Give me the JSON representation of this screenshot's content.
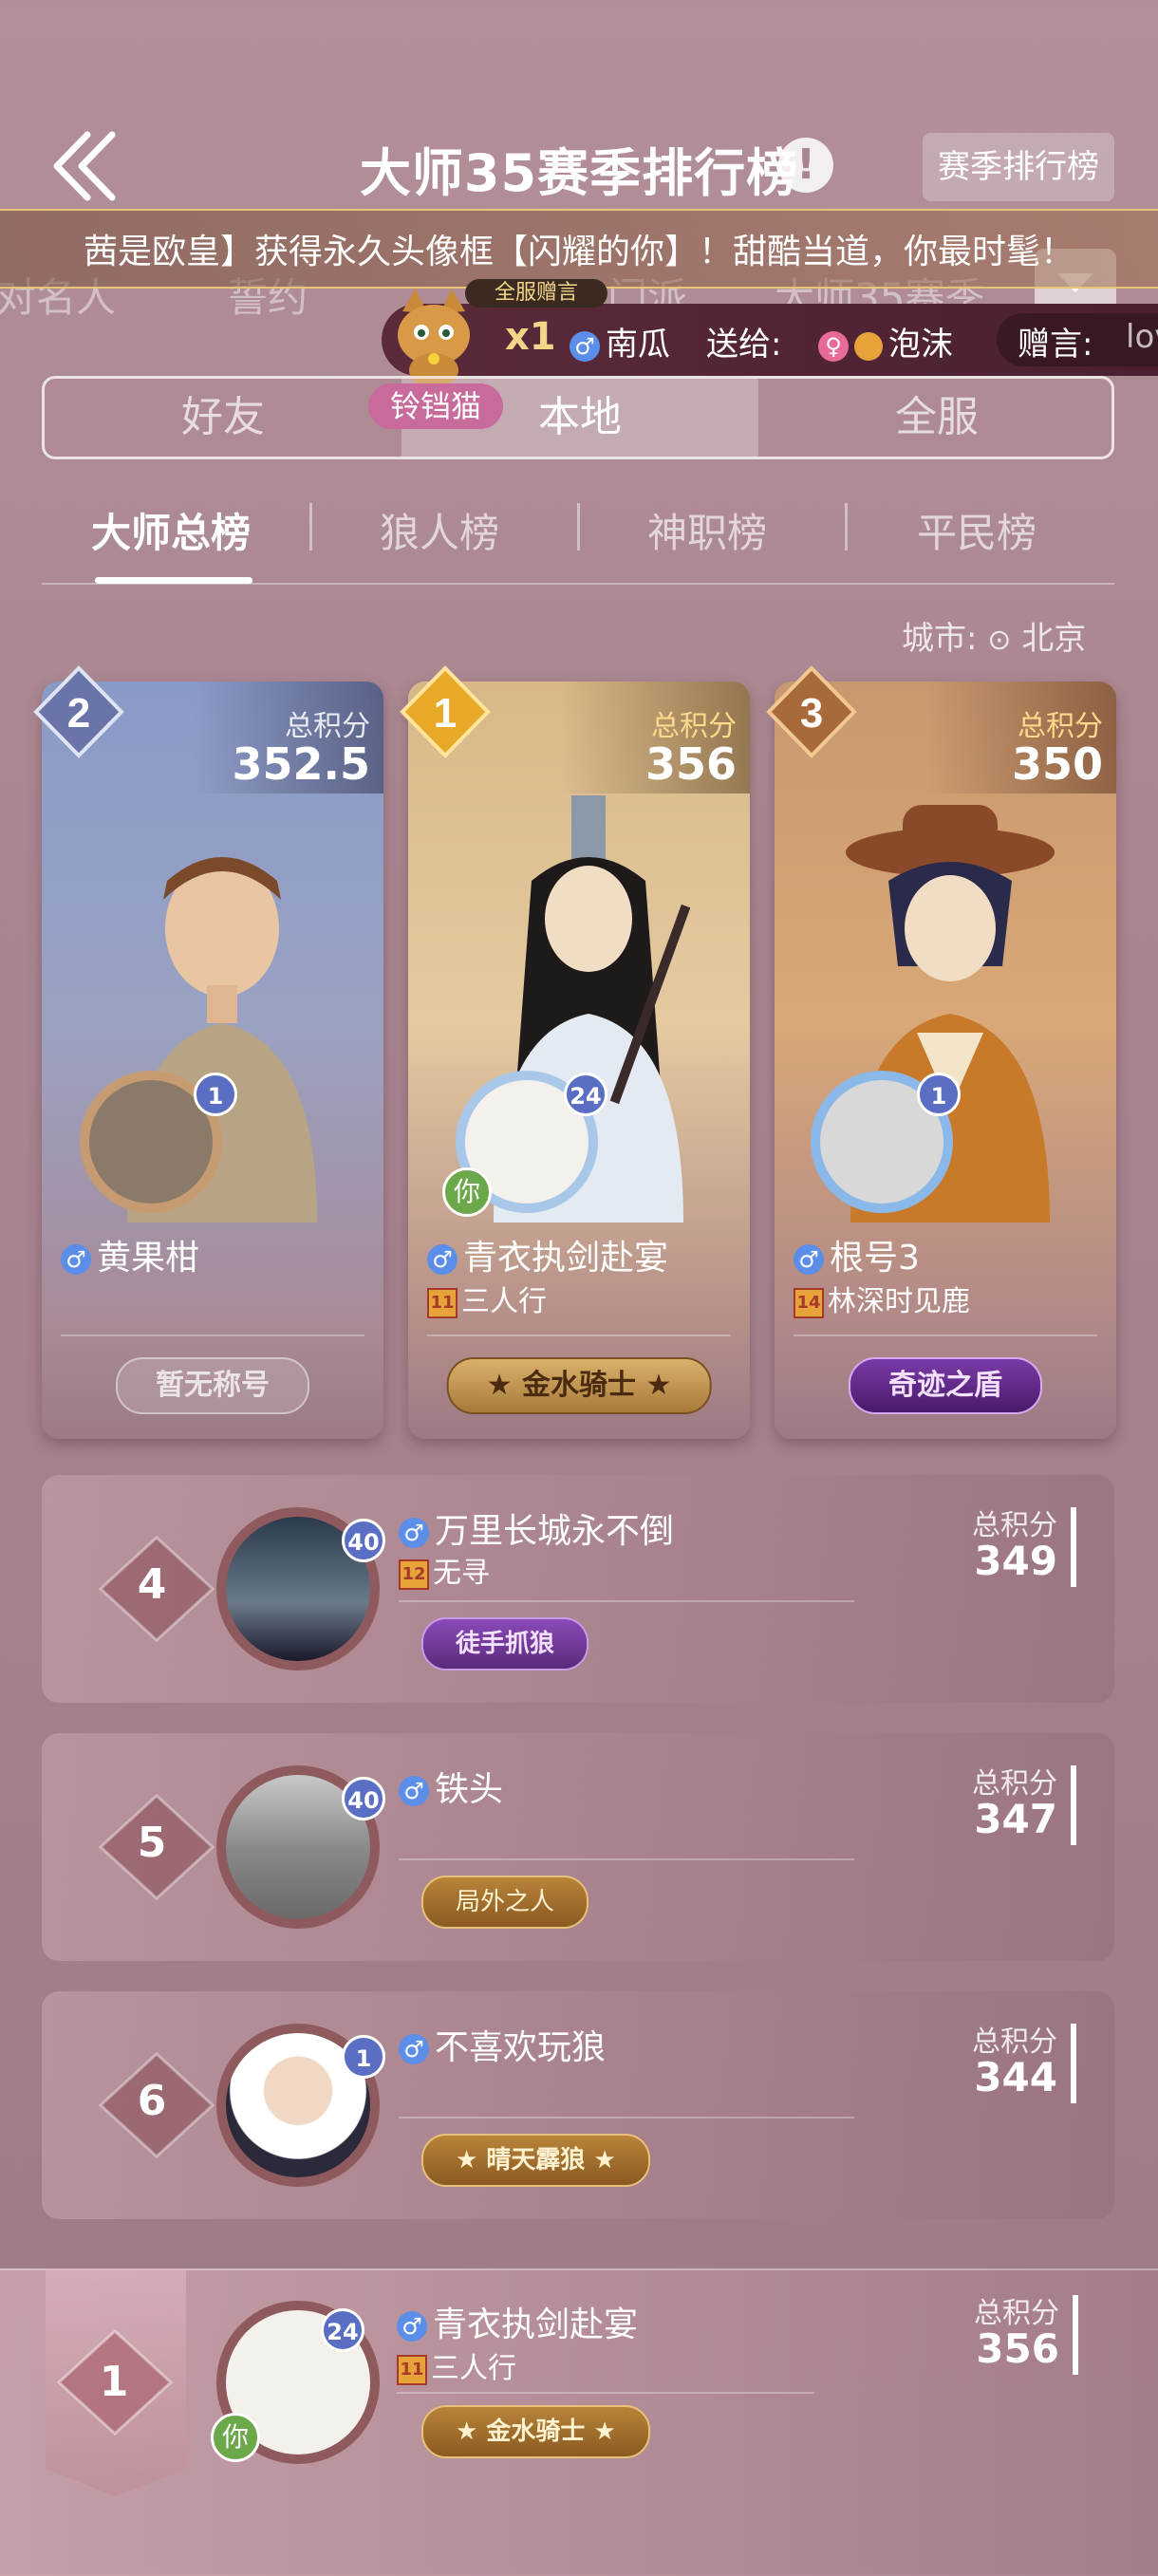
{
  "header": {
    "title": "大师35赛季排行榜",
    "info_icon": "!",
    "season_button": "赛季排行榜"
  },
  "marquee": {
    "text": "茜是欧皇】获得永久头像框【闪耀的你】！甜酷当道，你最时髦！"
  },
  "faded_tabs": [
    "对名人",
    "誓约",
    "门派",
    "大师35赛季"
  ],
  "gift": {
    "badge": "全服赠言",
    "count": "x1",
    "sender": "南瓜",
    "send_label": "送给:",
    "receiver": "泡沫",
    "message_label": "赠言:",
    "message_preview": "lov",
    "cat_name": "铃铛猫"
  },
  "scope_tabs": {
    "friends": "好友",
    "local": "本地",
    "server": "全服"
  },
  "category_tabs": {
    "master": "大师总榜",
    "werewolf": "狼人榜",
    "god": "神职榜",
    "villager": "平民榜"
  },
  "city": {
    "label": "城市:",
    "value": "北京"
  },
  "score_label": "总积分",
  "podium": [
    {
      "rank": "2",
      "score": "352.5",
      "name": "黄果柑",
      "guild_tag": "",
      "guild": "",
      "level": "1",
      "title": "暂无称号",
      "is_you": false
    },
    {
      "rank": "1",
      "score": "356",
      "name": "青衣执剑赴宴",
      "guild_tag": "11",
      "guild": "三人行",
      "level": "24",
      "title": "金水骑士",
      "is_you": true,
      "you_label": "你"
    },
    {
      "rank": "3",
      "score": "350",
      "name": "根号3",
      "guild_tag": "14",
      "guild": "林深时见鹿",
      "level": "1",
      "title": "奇迹之盾",
      "is_you": false
    }
  ],
  "rows": [
    {
      "rank": "4",
      "name": "万里长城永不倒",
      "guild_tag": "12",
      "guild": "无寻",
      "level": "40",
      "badge": "徒手抓狼",
      "score": "349"
    },
    {
      "rank": "5",
      "name": "铁头",
      "guild_tag": "",
      "guild": "",
      "level": "40",
      "badge": "局外之人",
      "score": "347"
    },
    {
      "rank": "6",
      "name": "不喜欢玩狼",
      "guild_tag": "",
      "guild": "",
      "level": "1",
      "badge": "晴天霹狼",
      "score": "344"
    }
  ],
  "my_rank": {
    "rank": "1",
    "name": "青衣执剑赴宴",
    "guild_tag": "11",
    "guild": "三人行",
    "level": "24",
    "badge": "金水骑士",
    "score": "356",
    "you_label": "你"
  },
  "colors": {
    "accent_gold": "#e8c476",
    "male": "#5a8ee8",
    "female": "#e86a98",
    "level": "#5a6fc4"
  }
}
